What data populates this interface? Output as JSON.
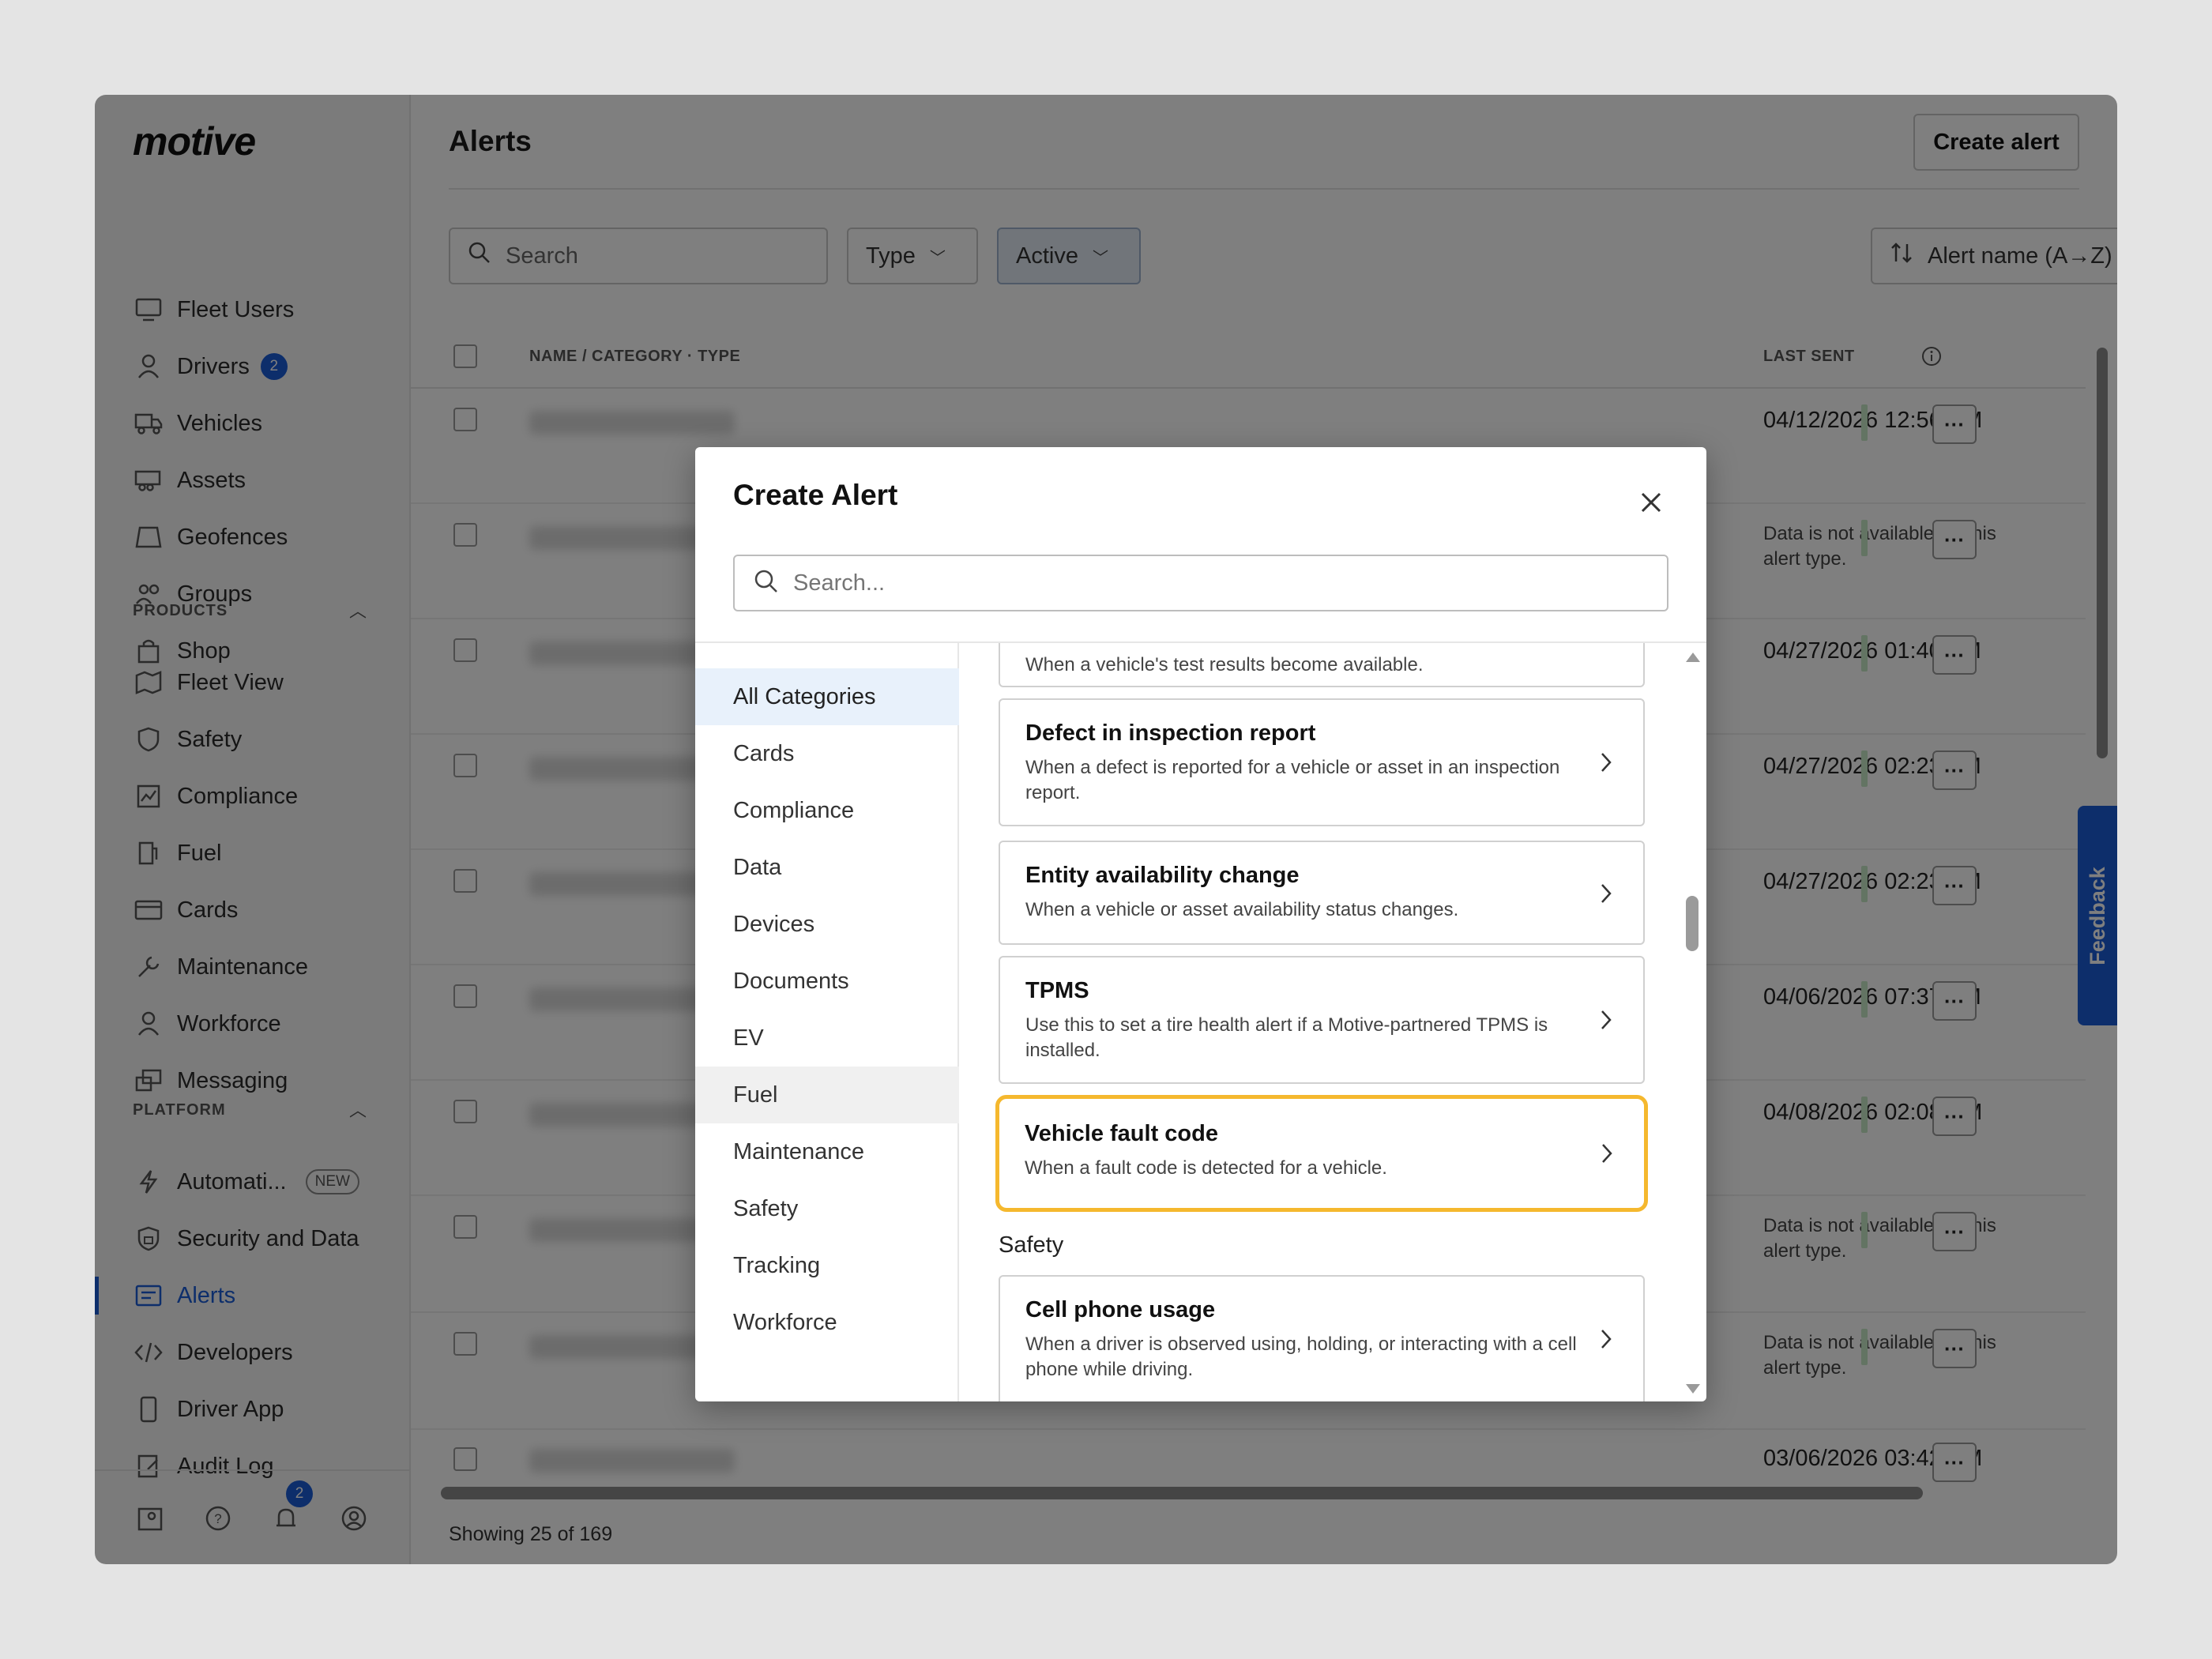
{
  "sidebar": {
    "logo": "motive",
    "items_top": [
      {
        "label": "Fleet Users",
        "icon": "monitor-icon"
      },
      {
        "label": "Drivers",
        "icon": "person-icon",
        "badge": "2"
      },
      {
        "label": "Vehicles",
        "icon": "truck-icon"
      },
      {
        "label": "Assets",
        "icon": "trailer-icon"
      },
      {
        "label": "Geofences",
        "icon": "geofence-icon"
      },
      {
        "label": "Groups",
        "icon": "group-icon"
      },
      {
        "label": "Shop",
        "icon": "shopping-bag-icon"
      }
    ],
    "products_label": "PRODUCTS",
    "items_products": [
      {
        "label": "Fleet View",
        "icon": "map-icon"
      },
      {
        "label": "Safety",
        "icon": "shield-icon"
      },
      {
        "label": "Compliance",
        "icon": "compliance-icon"
      },
      {
        "label": "Fuel",
        "icon": "fuel-icon"
      },
      {
        "label": "Cards",
        "icon": "card-icon"
      },
      {
        "label": "Maintenance",
        "icon": "wrench-icon"
      },
      {
        "label": "Workforce",
        "icon": "person-icon"
      },
      {
        "label": "Messaging",
        "icon": "messaging-icon"
      }
    ],
    "platform_label": "PLATFORM",
    "items_platform": [
      {
        "label": "Automati...",
        "icon": "lightning-icon",
        "tag": "NEW"
      },
      {
        "label": "Security and Data",
        "icon": "shield-lock-icon"
      },
      {
        "label": "Alerts",
        "icon": "alerts-icon",
        "active": true
      },
      {
        "label": "Developers",
        "icon": "code-icon"
      },
      {
        "label": "Driver App",
        "icon": "phone-icon"
      },
      {
        "label": "Audit Log",
        "icon": "audit-icon"
      }
    ],
    "footer_badge": "2"
  },
  "main": {
    "title": "Alerts",
    "create_button": "Create alert",
    "search_placeholder": "Search",
    "type_filter": "Type",
    "active_filter": "Active",
    "sort_label": "Alert name (A→Z)",
    "columns": {
      "name": "NAME / CATEGORY · TYPE",
      "last_sent": "LAST SENT"
    },
    "rows": [
      {
        "last_sent": "04/12/2026 12:56 PM"
      },
      {
        "last_sent": "Data is not available for this alert type."
      },
      {
        "last_sent": "04/27/2026 01:40 AM"
      },
      {
        "last_sent": "04/27/2026 02:23 AM"
      },
      {
        "last_sent": "04/27/2026 02:23 AM"
      },
      {
        "last_sent": "04/06/2026 07:37 AM"
      },
      {
        "last_sent": "04/08/2026 02:08 PM"
      },
      {
        "last_sent": "Data is not available for this alert type."
      },
      {
        "last_sent": "Data is not available for this alert type."
      },
      {
        "last_sent": "03/06/2026 03:42 PM"
      }
    ],
    "showing": "Showing 25 of 169",
    "feedback": "Feedback"
  },
  "modal": {
    "title": "Create Alert",
    "search_placeholder": "Search...",
    "categories": [
      "All Categories",
      "Cards",
      "Compliance",
      "Data",
      "Devices",
      "Documents",
      "EV",
      "Fuel",
      "Maintenance",
      "Safety",
      "Tracking",
      "Workforce"
    ],
    "partial_card_desc": "When a vehicle's test results become available.",
    "cards": [
      {
        "title": "Defect in inspection report",
        "desc": "When a defect is reported for a vehicle or asset in an inspection report."
      },
      {
        "title": "Entity availability change",
        "desc": "When a vehicle or asset availability status changes."
      },
      {
        "title": "TPMS",
        "desc": "Use this to set a tire health alert if a Motive-partnered TPMS is installed."
      },
      {
        "title": "Vehicle fault code",
        "desc": "When a fault code is detected for a vehicle."
      }
    ],
    "group_safety": "Safety",
    "safety_card": {
      "title": "Cell phone usage",
      "desc": "When a driver is observed using, holding, or interacting with a cell phone while driving."
    }
  }
}
